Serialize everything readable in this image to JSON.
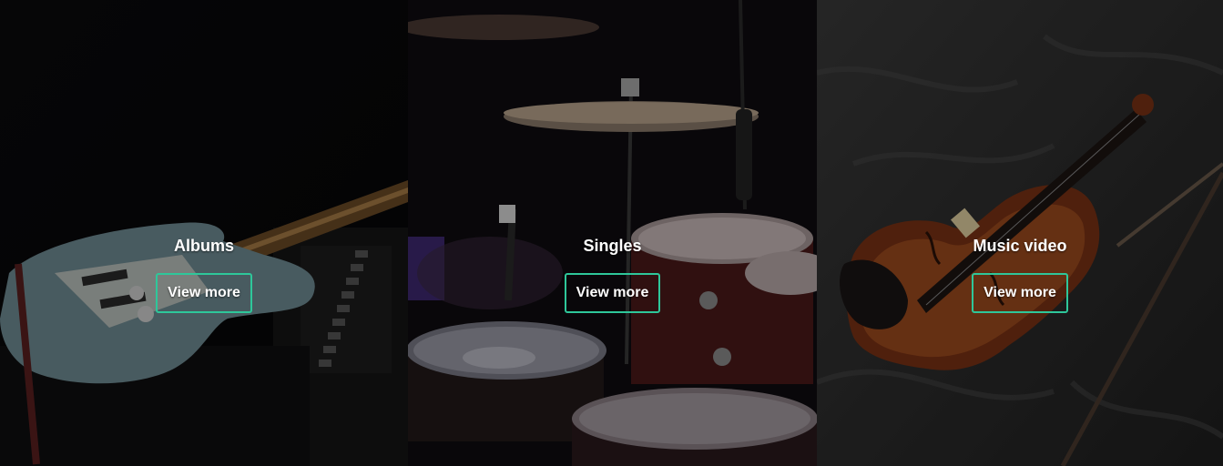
{
  "panels": [
    {
      "title": "Albums",
      "button_label": "View more",
      "image": "electric-guitar-on-amplifier-photo"
    },
    {
      "title": "Singles",
      "button_label": "View more",
      "image": "drum-kit-photo"
    },
    {
      "title": "Music video",
      "button_label": "View more",
      "image": "violin-on-bedsheet-photo"
    }
  ],
  "colors": {
    "button_border": "#2ec79a",
    "text": "#ffffff"
  }
}
